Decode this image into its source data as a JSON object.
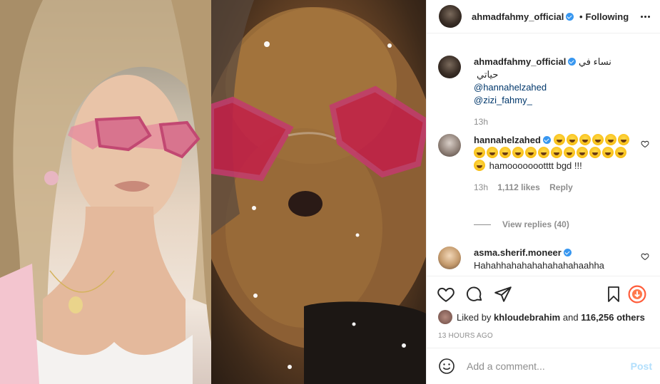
{
  "header": {
    "username": "ahmadfahmy_official",
    "separator": "•",
    "follow_status": "Following"
  },
  "caption": {
    "username": "ahmadfahmy_official",
    "text": "نساء في حياتي",
    "mentions": [
      "@hannahelzahed",
      "@zizi_fahmy_"
    ],
    "time": "13h"
  },
  "comments": [
    {
      "username": "hannahelzahed",
      "text": "hamoooooootttt bgd !!!",
      "emoji_count": 19,
      "time": "13h",
      "likes": "1,112 likes",
      "reply_label": "Reply",
      "view_replies": "View replies (40)"
    },
    {
      "username": "asma.sherif.moneer",
      "text": "Hahahhahahahahahahahaahha"
    }
  ],
  "likes": {
    "prefix": "Liked by",
    "user": "khloudebrahim",
    "and": "and",
    "others": "116,256 others"
  },
  "timestamp": "13 HOURS AGO",
  "comment_box": {
    "placeholder": "Add a comment...",
    "post_label": "Post"
  },
  "colors": {
    "verified": "#3897f0",
    "link": "#00376b",
    "post_disabled": "#b2dffc",
    "save_badge": "#ff5c3a"
  },
  "icons": [
    "heart-icon",
    "comment-icon",
    "share-icon",
    "bookmark-icon",
    "smile-icon",
    "more-icon",
    "verified-icon"
  ]
}
